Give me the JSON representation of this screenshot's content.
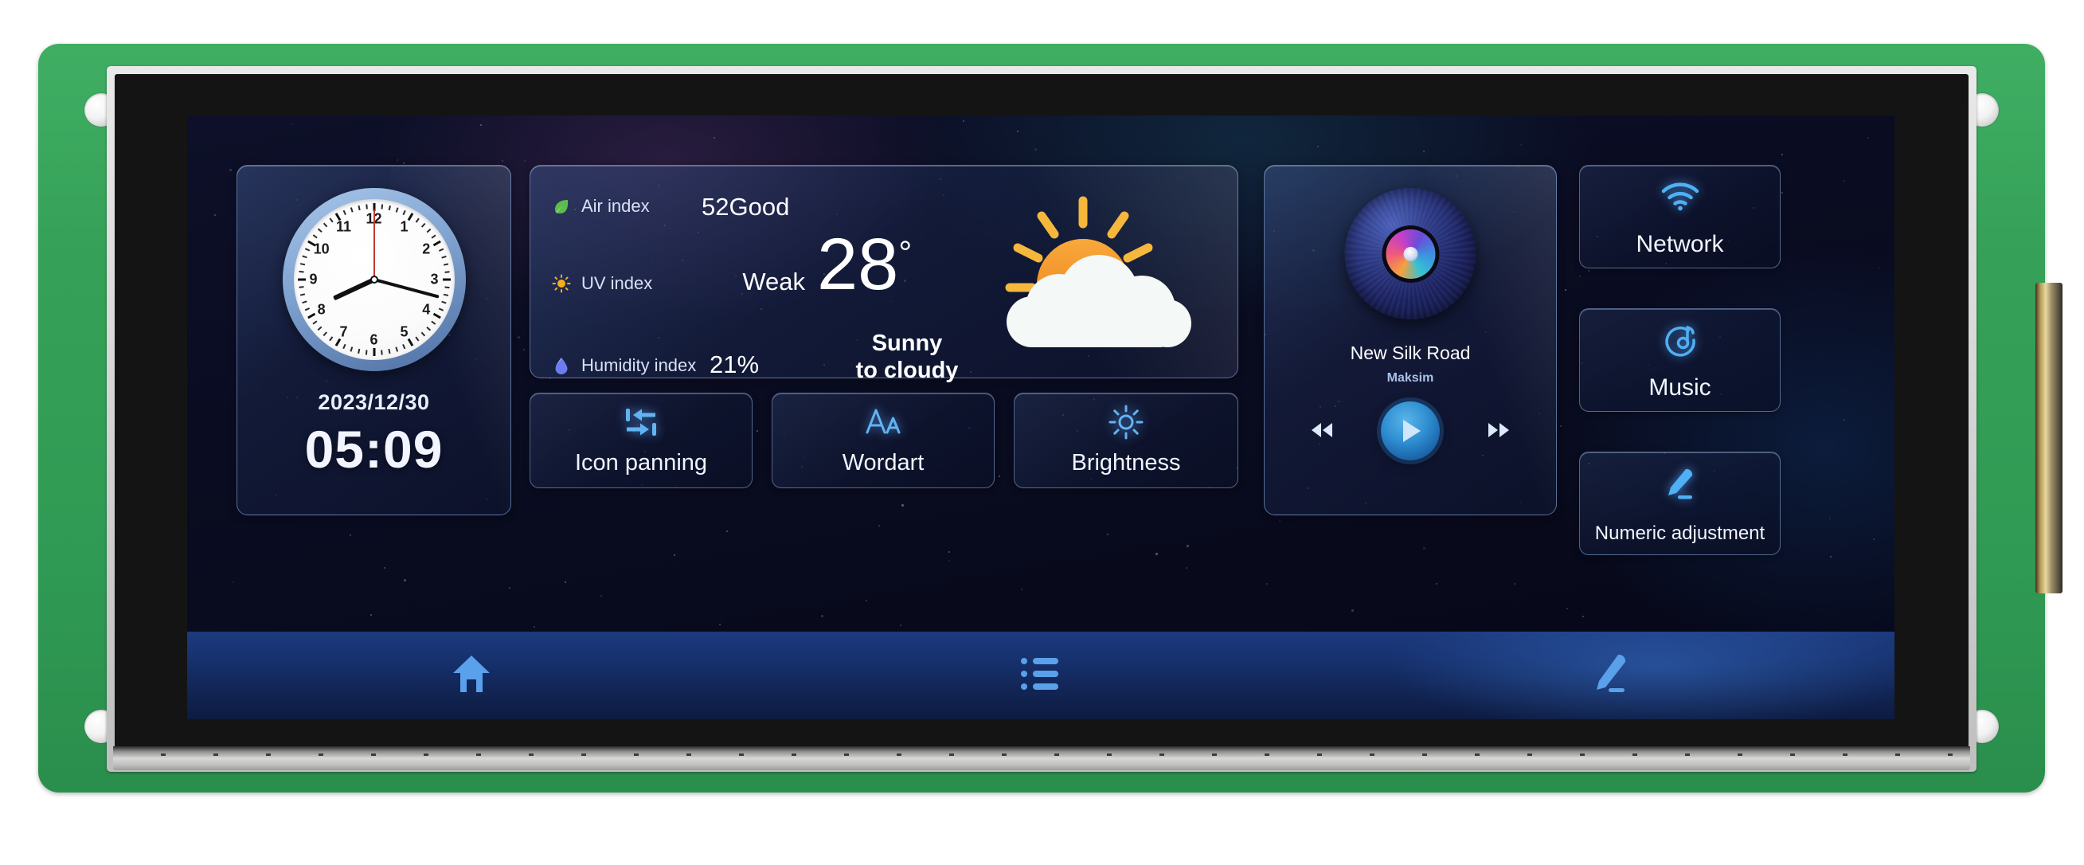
{
  "device": {
    "board_color": "#35a158",
    "screen_bg": "#0a0c22"
  },
  "clock": {
    "date": "2023/12/30",
    "time": "05:09",
    "numerals": [
      "12",
      "1",
      "2",
      "3",
      "4",
      "5",
      "6",
      "7",
      "8",
      "9",
      "10",
      "11"
    ],
    "hour_hand_deg": 245,
    "minute_hand_deg": 105,
    "second_hand_deg": 0,
    "face_color": "#ffffff",
    "rim_color": "#7ea2cf",
    "second_hand_color": "#c0392b"
  },
  "weather": {
    "rows": [
      {
        "icon": "leaf-icon",
        "glyph": "🍃",
        "label": "Air index",
        "value": "52Good"
      },
      {
        "icon": "sun-icon",
        "glyph": "☀",
        "label": "UV index",
        "value": "Weak"
      },
      {
        "icon": "droplet-icon",
        "glyph": "💧",
        "label": "Humidity index",
        "value": "21%"
      }
    ],
    "temperature": "28",
    "degree_symbol": "°",
    "condition_line1": "Sunny",
    "condition_line2": "to cloudy",
    "condition_icon": "sun-behind-cloud-icon",
    "sun_color": "#f08a24",
    "ray_color": "#f5b73c",
    "cloud_color": "#f4f8f6"
  },
  "actions": [
    {
      "label": "Icon panning",
      "icon": "panning-arrows-icon"
    },
    {
      "label": "Wordart",
      "icon": "font-size-aa-icon"
    },
    {
      "label": "Brightness",
      "icon": "brightness-sun-icon"
    }
  ],
  "music": {
    "title": "New Silk Road",
    "artist": "Maksim",
    "disc_icon": "vinyl-disc-icon",
    "prev_icon": "rewind-icon",
    "play_icon": "play-icon",
    "next_icon": "fast-forward-icon",
    "play_button_color": "#2f8fd2"
  },
  "side_buttons": [
    {
      "label": "Network",
      "icon": "wifi-icon"
    },
    {
      "label": "Music",
      "icon": "music-note-circle-icon"
    },
    {
      "label": "Numeric adjustment",
      "icon": "pencil-icon"
    }
  ],
  "navbar": [
    {
      "name": "home",
      "icon": "home-icon"
    },
    {
      "name": "list",
      "icon": "list-icon"
    },
    {
      "name": "edit",
      "icon": "pencil-icon"
    }
  ],
  "theme": {
    "accent": "#5aaaff",
    "card_border": "#96b9eb",
    "text_primary": "#ffffff",
    "text_secondary": "#a8c2e8"
  }
}
